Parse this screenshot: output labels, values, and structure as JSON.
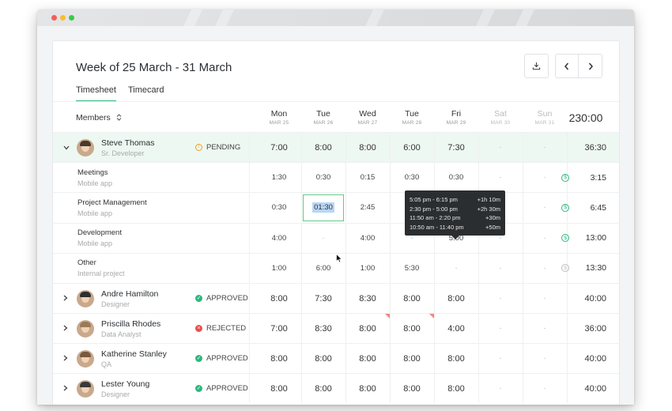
{
  "header": {
    "title": "Week of 25 March - 31 March",
    "tabs": [
      {
        "label": "Timesheet",
        "active": true
      },
      {
        "label": "Timecard",
        "active": false
      }
    ]
  },
  "toolbar": {
    "download_icon": "download-icon",
    "prev_icon": "chevron-left-icon",
    "next_icon": "chevron-right-icon"
  },
  "table": {
    "members_label": "Members",
    "sort_icon": "sort-icon",
    "total": "230:00",
    "days": [
      {
        "day": "Mon",
        "date": "MAR 25",
        "weekend": false
      },
      {
        "day": "Tue",
        "date": "MAR 26",
        "weekend": false
      },
      {
        "day": "Wed",
        "date": "MAR 27",
        "weekend": false
      },
      {
        "day": "Tue",
        "date": "MAR 28",
        "weekend": false
      },
      {
        "day": "Fri",
        "date": "MAR 29",
        "weekend": false
      },
      {
        "day": "Sat",
        "date": "MAR 30",
        "weekend": true
      },
      {
        "day": "Sun",
        "date": "MAR 31",
        "weekend": true
      }
    ]
  },
  "members": [
    {
      "name": "Steve Thomas",
      "role": "Sr. Developer",
      "status": "PENDING",
      "status_color": "#f0a020",
      "expanded": true,
      "hours": [
        "7:00",
        "8:00",
        "8:00",
        "6:00",
        "7:30",
        "-",
        "-"
      ],
      "total": "36:30"
    },
    {
      "name": "Andre Hamilton",
      "role": "Designer",
      "status": "APPROVED",
      "status_color": "#2fb57e",
      "expanded": false,
      "hours": [
        "8:00",
        "7:30",
        "8:30",
        "8:00",
        "8:00",
        "-",
        "-"
      ],
      "total": "40:00"
    },
    {
      "name": "Priscilla Rhodes",
      "role": "Data Analyst",
      "status": "REJECTED",
      "status_color": "#e8504a",
      "expanded": false,
      "hours": [
        "7:00",
        "8:30",
        "8:00",
        "8:00",
        "4:00",
        "-",
        "-"
      ],
      "total": "36:00"
    },
    {
      "name": "Katherine Stanley",
      "role": "QA",
      "status": "APPROVED",
      "status_color": "#2fb57e",
      "expanded": false,
      "hours": [
        "8:00",
        "8:00",
        "8:00",
        "8:00",
        "8:00",
        "-",
        "-"
      ],
      "total": "40:00"
    },
    {
      "name": "Lester Young",
      "role": "Designer",
      "status": "APPROVED",
      "status_color": "#2fb57e",
      "expanded": false,
      "hours": [
        "8:00",
        "8:00",
        "8:00",
        "8:00",
        "8:00",
        "-",
        "-"
      ],
      "total": "40:00"
    }
  ],
  "tasks": [
    {
      "name": "Meetings",
      "project": "Mobile app",
      "hours": [
        "1:30",
        "0:30",
        "0:15",
        "0:30",
        "0:30",
        "-",
        "-"
      ],
      "total": "3:15",
      "billable": true
    },
    {
      "name": "Project Management",
      "project": "Mobile app",
      "hours": [
        "0:30",
        "01:30",
        "2:45",
        "",
        "",
        "-",
        "-"
      ],
      "total": "6:45",
      "billable": true
    },
    {
      "name": "Development",
      "project": "Mobile app",
      "hours": [
        "4:00",
        "-",
        "4:00",
        "-",
        "5:00",
        "-",
        "-"
      ],
      "total": "13:00",
      "billable": true
    },
    {
      "name": "Other",
      "project": "Internal project",
      "hours": [
        "1:00",
        "6:00",
        "1:00",
        "5:30",
        "-",
        "-",
        "-"
      ],
      "total": "13:30",
      "billable": false
    }
  ],
  "tooltip": {
    "entries": [
      {
        "range": "5:05 pm - 6:15 pm",
        "delta": "+1h 10m"
      },
      {
        "range": "2:30 pm - 5:00 pm",
        "delta": "+2h 30m"
      },
      {
        "range": "11:50 am - 2:20 pm",
        "delta": "+30m"
      },
      {
        "range": "10:50 am - 11:40 pm",
        "delta": "+50m"
      }
    ]
  },
  "colors": {
    "accent": "#2fb57e",
    "pending": "#f0a020",
    "rejected": "#e8504a",
    "highlight_row": "#eef8f2"
  }
}
